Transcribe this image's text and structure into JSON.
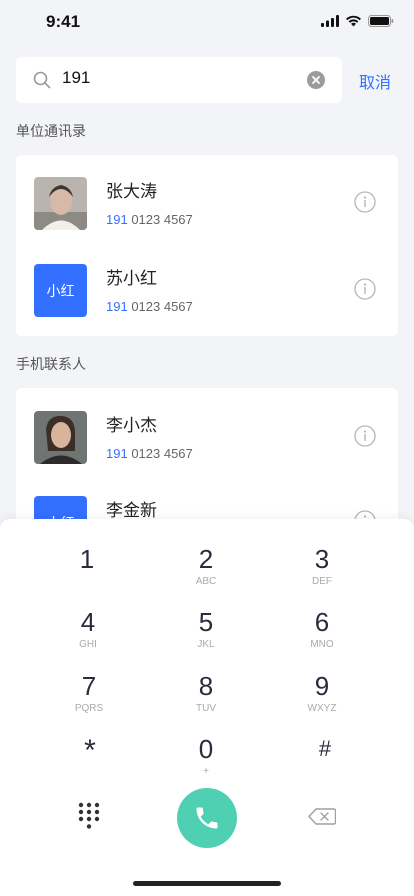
{
  "status": {
    "time": "9:41"
  },
  "search": {
    "value": "191",
    "cancel_label": "取消"
  },
  "sections": {
    "work": {
      "title": "单位通讯录",
      "contacts": [
        {
          "name": "张大涛",
          "phone_match": "191",
          "phone_rest": " 0123 4567",
          "avatar": "photo"
        },
        {
          "name": "苏小红",
          "phone_match": "191",
          "phone_rest": " 0123 4567",
          "avatar_text": "小红"
        }
      ]
    },
    "phone": {
      "title": "手机联系人",
      "contacts": [
        {
          "name": "李小杰",
          "phone_match": "191",
          "phone_rest": " 0123 4567",
          "avatar": "photo"
        },
        {
          "name": "李金新",
          "avatar_text": "小红"
        }
      ]
    }
  },
  "keypad": {
    "keys": [
      {
        "digit": "1",
        "letters": ""
      },
      {
        "digit": "2",
        "letters": "ABC"
      },
      {
        "digit": "3",
        "letters": "DEF"
      },
      {
        "digit": "4",
        "letters": "GHI"
      },
      {
        "digit": "5",
        "letters": "JKL"
      },
      {
        "digit": "6",
        "letters": "MNO"
      },
      {
        "digit": "7",
        "letters": "PQRS"
      },
      {
        "digit": "8",
        "letters": "TUV"
      },
      {
        "digit": "9",
        "letters": "WXYZ"
      },
      {
        "digit": "*",
        "letters": ""
      },
      {
        "digit": "0",
        "letters": "+"
      },
      {
        "digit": "#",
        "letters": ""
      }
    ]
  },
  "colors": {
    "accent": "#3370ff",
    "call": "#4fd0b3",
    "background": "#f3f4f8"
  },
  "icons": [
    "search-icon",
    "clear-icon",
    "info-icon",
    "dialpad-icon",
    "phone-icon",
    "backspace-icon"
  ]
}
